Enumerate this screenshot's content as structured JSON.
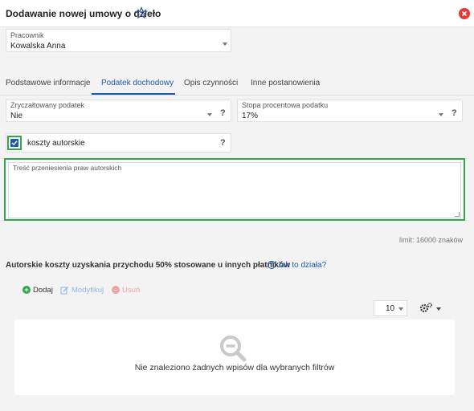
{
  "header": {
    "title": "Dodawanie nowej umowy o dzieło"
  },
  "employee": {
    "label": "Pracownik",
    "value": "Kowalska Anna"
  },
  "tabs": [
    {
      "label": "Podstawowe informacje",
      "active": false
    },
    {
      "label": "Podatek dochodowy",
      "active": true
    },
    {
      "label": "Opis czynności",
      "active": false
    },
    {
      "label": "Inne postanowienia",
      "active": false
    }
  ],
  "lump_tax": {
    "label": "Zryczałtowany podatek",
    "value": "Nie",
    "help": "?"
  },
  "tax_rate": {
    "label": "Stopa procentowa podatku",
    "value": "17%",
    "help": "?"
  },
  "author_costs": {
    "label": "koszty autorskie",
    "checked": true,
    "help": "?"
  },
  "rights_transfer": {
    "label": "Treść przeniesienia praw autorskich",
    "value": ""
  },
  "limit_text": "limit: 16000 znaków",
  "section": {
    "title": "Autorskie koszty uzyskania przychodu 50% stosowane u innych płatników",
    "help_link": "Jak to działa?"
  },
  "toolbar": {
    "add": "Dodaj",
    "edit": "Modyfikuj",
    "delete": "Usuń"
  },
  "pagination": {
    "page_size": "10"
  },
  "empty": {
    "message": "Nie znaleziono żadnych wpisów dla wybranych filtrów"
  },
  "colors": {
    "accent": "#1e5aa8",
    "highlight": "#2eaa4a",
    "danger": "#e53935",
    "add": "#2eaa4a",
    "edit": "#8fb4e6",
    "delete": "#f0a0a0"
  }
}
